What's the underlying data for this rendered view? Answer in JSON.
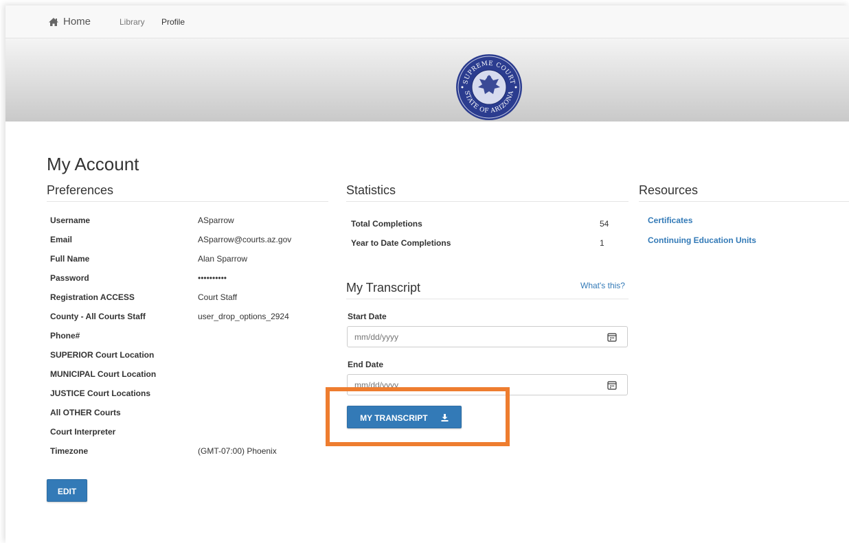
{
  "nav": {
    "home": "Home",
    "library": "Library",
    "profile": "Profile"
  },
  "seal": {
    "top_text": "SUPREME COURT",
    "bottom_text": "STATE OF ARIZONA",
    "color": "#2b3c8f"
  },
  "page": {
    "title": "My Account"
  },
  "preferences": {
    "title": "Preferences",
    "rows": [
      {
        "label": "Username",
        "value": "ASparrow"
      },
      {
        "label": "Email",
        "value": "ASparrow@courts.az.gov"
      },
      {
        "label": "Full Name",
        "value": "Alan Sparrow"
      },
      {
        "label": "Password",
        "value": "••••••••••"
      },
      {
        "label": "Registration ACCESS",
        "value": "Court Staff"
      },
      {
        "label": "County - All Courts Staff",
        "value": "user_drop_options_2924"
      },
      {
        "label": "Phone#",
        "value": ""
      },
      {
        "label": "SUPERIOR Court Location",
        "value": ""
      },
      {
        "label": "MUNICIPAL Court Location",
        "value": ""
      },
      {
        "label": "JUSTICE Court Locations",
        "value": ""
      },
      {
        "label": "All OTHER Courts",
        "value": ""
      },
      {
        "label": "Court Interpreter",
        "value": ""
      },
      {
        "label": "Timezone",
        "value": "(GMT-07:00) Phoenix"
      }
    ],
    "edit_label": "EDIT"
  },
  "statistics": {
    "title": "Statistics",
    "rows": [
      {
        "label": "Total Completions",
        "value": "54"
      },
      {
        "label": "Year to Date Completions",
        "value": "1"
      }
    ]
  },
  "transcript": {
    "title": "My Transcript",
    "whats_this": "What's this?",
    "start_label": "Start Date",
    "start_placeholder": "mm/dd/yyyy",
    "end_label": "End Date",
    "end_placeholder": "mm/dd/yyyy",
    "button_label": "MY TRANSCRIPT"
  },
  "resources": {
    "title": "Resources",
    "links": [
      "Certificates",
      "Continuing Education Units"
    ]
  },
  "colors": {
    "accent": "#337ab7",
    "highlight": "#ee7d2f"
  }
}
